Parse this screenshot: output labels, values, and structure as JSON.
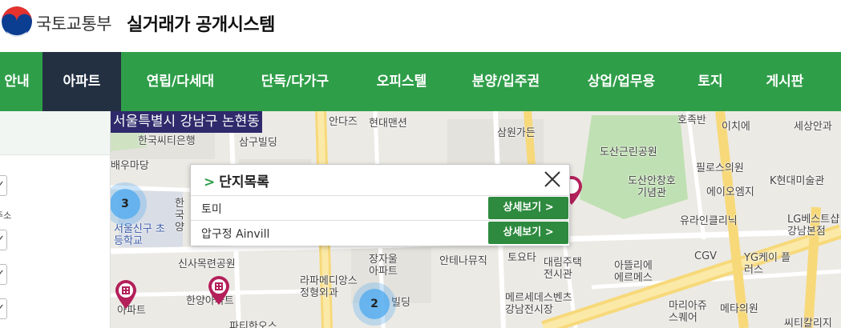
{
  "header": {
    "ministry": "국토교통부",
    "system": "실거래가 공개시스템"
  },
  "nav": {
    "items": [
      {
        "label": "안내",
        "active": false
      },
      {
        "label": "아파트",
        "active": true
      },
      {
        "label": "연립/다세대",
        "active": false
      },
      {
        "label": "단독/다가구",
        "active": false
      },
      {
        "label": "오피스텔",
        "active": false
      },
      {
        "label": "분양/입주권",
        "active": false
      },
      {
        "label": "상업/업무용",
        "active": false
      },
      {
        "label": "토지",
        "active": false
      },
      {
        "label": "게시판",
        "active": false
      }
    ]
  },
  "left_panel": {
    "label": "주소"
  },
  "map": {
    "region": "서울특별시 강남구 논현동",
    "labels": [
      "안다즈",
      "현대맨션",
      "삼원가든",
      "한국씨티은행",
      "삼구빌딩",
      "배우마당",
      "도산근린공원",
      "도산안창호 기념관",
      "필로스의원",
      "에이오엠지",
      "K현대미술관",
      "호족반",
      "이치에",
      "세상안과",
      "유라인클리닉",
      "LG베스트샵 강남본점",
      "CGV",
      "YG케이 플러스",
      "서울신구 초등학교",
      "신사목련공원",
      "장자울 아파트",
      "안테나뮤직",
      "토요타",
      "대림주택 전시관",
      "아뜰리에 에르메스",
      "라파메디앙스 정형외과",
      "메르세데스벤츠 강남전시장",
      "마리아쥬 스퀘어",
      "메타의원",
      "씨티칼리지",
      "한양아파트",
      "아파트",
      "빌딩",
      "파티한오스",
      "한국 양"
    ],
    "clusters": [
      {
        "count": "3"
      },
      {
        "count": "2"
      }
    ]
  },
  "popup": {
    "title": "단지목록",
    "items": [
      {
        "name": "토미",
        "button": "상세보기"
      },
      {
        "name": "압구정 Ainvill",
        "button": "상세보기"
      }
    ]
  },
  "colors": {
    "nav_bg": "#2f9e49",
    "nav_active": "#233042",
    "region_bg": "#2e2a6b",
    "button_bg": "#2d8a3e",
    "road_yellow": "#f7d97a",
    "park_green": "#bfe0b2",
    "cluster_blue": "#50aaf0",
    "pin_color": "#b3205a"
  }
}
